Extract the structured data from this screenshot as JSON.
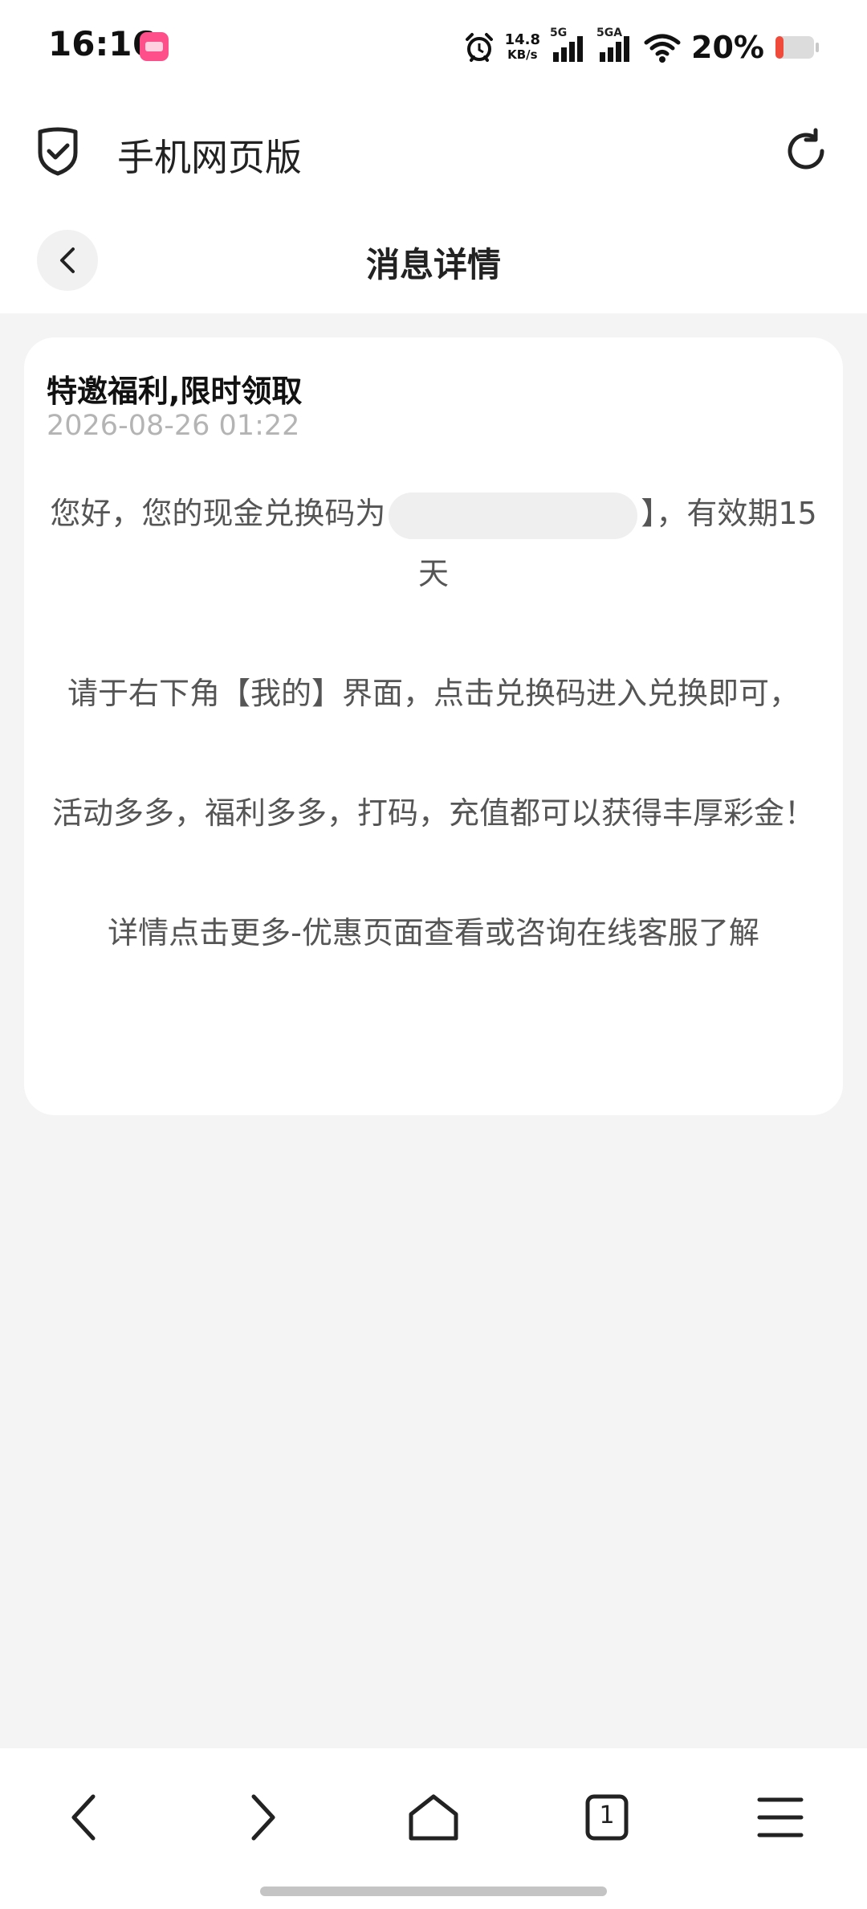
{
  "status_bar": {
    "time": "16:16",
    "net_speed_value": "14.8",
    "net_speed_unit": "KB/s",
    "signal_1_label": "5G",
    "signal_2_label": "5GA",
    "battery_percent": "20%",
    "battery_color": "#f04a3a",
    "app_icon": "lala-app-icon",
    "icons": [
      "alarm-icon",
      "signal-icon",
      "wifi-icon",
      "battery-icon"
    ]
  },
  "browser": {
    "title": "手机网页版",
    "left_icon": "shield-check-icon",
    "right_icon": "refresh-icon"
  },
  "page": {
    "title": "消息详情",
    "back_icon": "chevron-left-icon"
  },
  "message": {
    "title": "特邀福利,限时领取",
    "date": "2026-08-26 01:22",
    "p1_before": "您好，您的现金兑换码为",
    "p1_after": "】，有效期15天",
    "p2": "请于右下角【我的】界面，点击兑换码进入兑换即可，",
    "p3": "活动多多，福利多多，打码，充值都可以获得丰厚彩金！",
    "p4": "详情点击更多-优惠页面查看或咨询在线客服了解"
  },
  "bottom_nav": {
    "tab_count": "1",
    "icons": [
      "back-icon",
      "forward-icon",
      "home-icon",
      "tabs-icon",
      "menu-icon"
    ]
  }
}
